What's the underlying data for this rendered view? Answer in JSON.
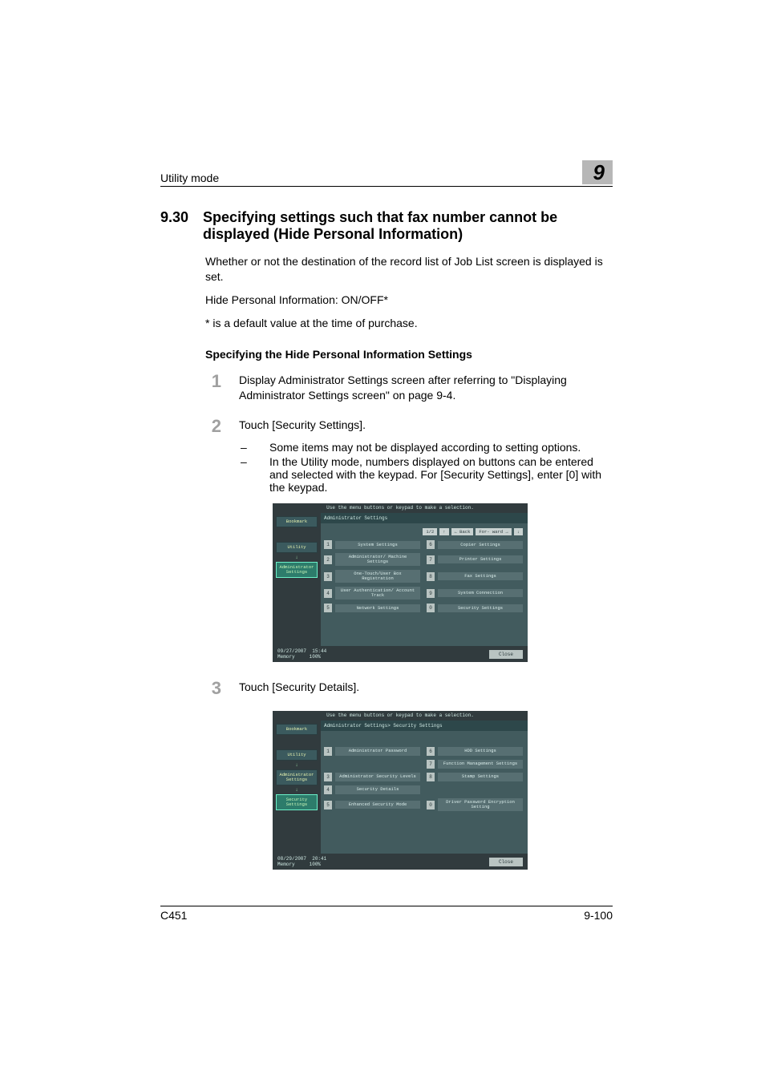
{
  "header": {
    "left": "Utility mode",
    "chapter": "9"
  },
  "section": {
    "number": "9.30",
    "title": "Specifying settings such that fax number cannot be displayed (Hide Personal Information)"
  },
  "intro": [
    "Whether or not the destination of the record list of Job List screen is displayed is set.",
    "Hide Personal Information: ON/OFF*",
    "* is a default value at the time of purchase."
  ],
  "subhead": "Specifying the Hide Personal Information Settings",
  "steps": [
    {
      "n": "1",
      "text": "Display Administrator Settings screen after referring to \"Displaying Administrator Settings screen\" on page 9-4.",
      "bullets": []
    },
    {
      "n": "2",
      "text": "Touch [Security Settings].",
      "bullets": [
        "Some items may not be displayed according to setting options.",
        "In the Utility mode, numbers displayed on buttons can be entered and selected with the keypad. For [Security Settings], enter [0] with the keypad."
      ]
    },
    {
      "n": "3",
      "text": "Touch [Security Details].",
      "bullets": []
    }
  ],
  "screen1": {
    "instruction": "Use the menu buttons or keypad to make a selection.",
    "breadcrumb": "Administrator Settings",
    "sidebar": [
      "Bookmark",
      "Utility",
      "Administrator Settings"
    ],
    "topbar": {
      "page": "1/2",
      "arrowL": "↑",
      "back": "← Back",
      "fwd": "For- ward →",
      "arrowR": "↓"
    },
    "left": [
      {
        "i": "1",
        "t": "System Settings"
      },
      {
        "i": "2",
        "t": "Administrator/ Machine Settings"
      },
      {
        "i": "3",
        "t": "One-Touch/User Box Registration"
      },
      {
        "i": "4",
        "t": "User Authentication/ Account Track"
      },
      {
        "i": "5",
        "t": "Network Settings"
      }
    ],
    "right": [
      {
        "i": "6",
        "t": "Copier Settings"
      },
      {
        "i": "7",
        "t": "Printer Settings"
      },
      {
        "i": "8",
        "t": "Fax Settings"
      },
      {
        "i": "9",
        "t": "System Connection"
      },
      {
        "i": "0",
        "t": "Security Settings"
      }
    ],
    "footer": {
      "date": "09/27/2007",
      "time": "15:44",
      "mem": "Memory",
      "pct": "100%",
      "close": "Close"
    }
  },
  "screen2": {
    "instruction": "Use the menu buttons or keypad to make a selection.",
    "breadcrumb": "Administrator Settings> Security Settings",
    "sidebar": [
      "Bookmark",
      "Utility",
      "Administrator Settings",
      "Security Settings"
    ],
    "left": [
      {
        "i": "1",
        "t": "Administrator Password"
      },
      {
        "i": "",
        "t": ""
      },
      {
        "i": "3",
        "t": "Administrator Security Levels"
      },
      {
        "i": "4",
        "t": "Security Details"
      },
      {
        "i": "5",
        "t": "Enhanced Security Mode"
      }
    ],
    "right": [
      {
        "i": "6",
        "t": "HDD Settings"
      },
      {
        "i": "7",
        "t": "Function Management Settings"
      },
      {
        "i": "8",
        "t": "Stamp Settings"
      },
      {
        "i": "",
        "t": ""
      },
      {
        "i": "0",
        "t": "Driver Password Encryption Setting"
      }
    ],
    "footer": {
      "date": "08/29/2007",
      "time": "20:41",
      "mem": "Memory",
      "pct": "100%",
      "close": "Close"
    }
  },
  "footer": {
    "left": "C451",
    "right": "9-100"
  }
}
